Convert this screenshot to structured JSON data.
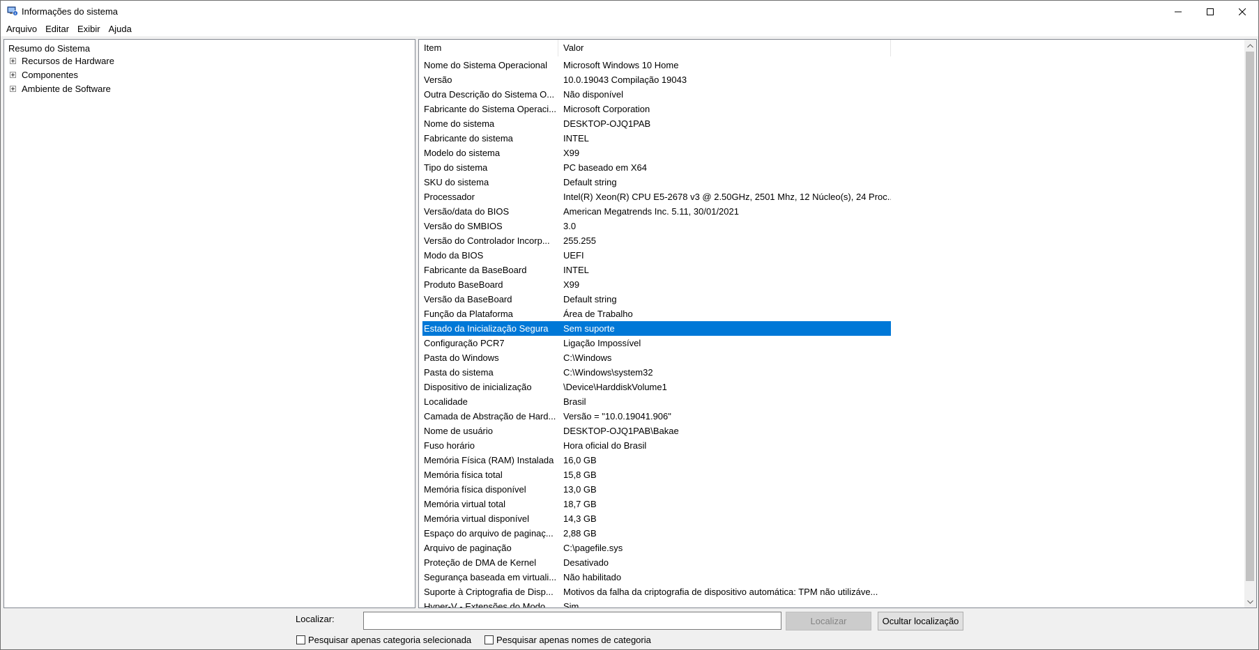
{
  "window": {
    "title": "Informações do sistema"
  },
  "menu": [
    "Arquivo",
    "Editar",
    "Exibir",
    "Ajuda"
  ],
  "tree": {
    "root": "Resumo do Sistema",
    "nodes": [
      "Recursos de Hardware",
      "Componentes",
      "Ambiente de Software"
    ]
  },
  "list": {
    "columns": {
      "item": "Item",
      "value": "Valor"
    },
    "rows": [
      {
        "item": "Nome do Sistema Operacional",
        "value": "Microsoft Windows 10 Home"
      },
      {
        "item": "Versão",
        "value": "10.0.19043 Compilação 19043"
      },
      {
        "item": "Outra Descrição do Sistema O...",
        "value": "Não disponível"
      },
      {
        "item": "Fabricante do Sistema Operaci...",
        "value": "Microsoft Corporation"
      },
      {
        "item": "Nome do sistema",
        "value": "DESKTOP-OJQ1PAB"
      },
      {
        "item": "Fabricante do sistema",
        "value": "INTEL"
      },
      {
        "item": "Modelo do sistema",
        "value": "X99"
      },
      {
        "item": "Tipo do sistema",
        "value": "PC baseado em X64"
      },
      {
        "item": "SKU do sistema",
        "value": "Default string"
      },
      {
        "item": "Processador",
        "value": "Intel(R) Xeon(R) CPU E5-2678 v3 @ 2.50GHz, 2501 Mhz, 12 Núcleo(s), 24 Proc..."
      },
      {
        "item": "Versão/data do BIOS",
        "value": "American Megatrends Inc. 5.11, 30/01/2021"
      },
      {
        "item": "Versão do SMBIOS",
        "value": "3.0"
      },
      {
        "item": "Versão do Controlador Incorp...",
        "value": "255.255"
      },
      {
        "item": "Modo da BIOS",
        "value": "UEFI"
      },
      {
        "item": "Fabricante da BaseBoard",
        "value": "INTEL"
      },
      {
        "item": "Produto BaseBoard",
        "value": "X99"
      },
      {
        "item": "Versão da BaseBoard",
        "value": "Default string"
      },
      {
        "item": "Função da Plataforma",
        "value": "Área de Trabalho"
      },
      {
        "item": "Estado da Inicialização Segura",
        "value": "Sem suporte",
        "selected": true
      },
      {
        "item": "Configuração PCR7",
        "value": "Ligação Impossível"
      },
      {
        "item": "Pasta do Windows",
        "value": "C:\\Windows"
      },
      {
        "item": "Pasta do sistema",
        "value": "C:\\Windows\\system32"
      },
      {
        "item": "Dispositivo de inicialização",
        "value": "\\Device\\HarddiskVolume1"
      },
      {
        "item": "Localidade",
        "value": "Brasil"
      },
      {
        "item": "Camada de Abstração de Hard...",
        "value": "Versão = \"10.0.19041.906\""
      },
      {
        "item": "Nome de usuário",
        "value": "DESKTOP-OJQ1PAB\\Bakae"
      },
      {
        "item": "Fuso horário",
        "value": "Hora oficial do Brasil"
      },
      {
        "item": "Memória Física (RAM) Instalada",
        "value": "16,0 GB"
      },
      {
        "item": "Memória física total",
        "value": "15,8 GB"
      },
      {
        "item": "Memória física disponível",
        "value": "13,0 GB"
      },
      {
        "item": "Memória virtual total",
        "value": "18,7 GB"
      },
      {
        "item": "Memória virtual disponível",
        "value": "14,3 GB"
      },
      {
        "item": "Espaço do arquivo de paginaç...",
        "value": "2,88 GB"
      },
      {
        "item": "Arquivo de paginação",
        "value": "C:\\pagefile.sys"
      },
      {
        "item": "Proteção de DMA de Kernel",
        "value": "Desativado"
      },
      {
        "item": "Segurança baseada em virtuali...",
        "value": "Não habilitado"
      },
      {
        "item": "Suporte à Criptografia de Disp...",
        "value": "Motivos da falha da criptografia de dispositivo automática: TPM não utilizáve..."
      },
      {
        "item": "Hyper-V - Extensões do Modo ...",
        "value": "Sim"
      }
    ]
  },
  "find": {
    "label": "Localizar:",
    "input_value": "",
    "find_button": "Localizar",
    "hide_button": "Ocultar localização",
    "checkbox_selected_category": "Pesquisar apenas categoria selecionada",
    "checkbox_category_names": "Pesquisar apenas nomes de categoria"
  },
  "colors": {
    "selection": "#0078d7"
  }
}
